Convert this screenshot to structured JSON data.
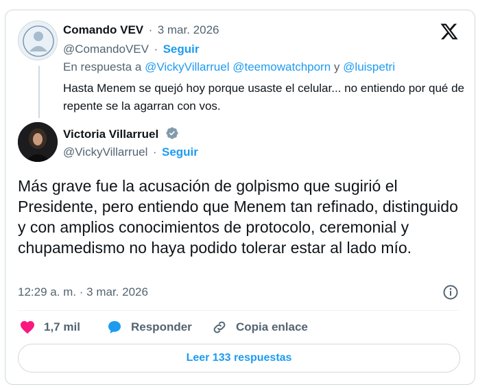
{
  "reply_tweet": {
    "author_name": "Comando VEV",
    "separator": "·",
    "date": "3 mar. 2026",
    "handle": "@ComandoVEV",
    "follow_label": "Seguir",
    "reply_prefix": "En respuesta a",
    "reply_to": [
      "@VickyVillarruel",
      "@teemowatchporn",
      "@luispetri"
    ],
    "reply_joiner": "y",
    "text": "Hasta Menem se quejó hoy porque usaste el celular... no entiendo por qué de repente se la agarran con vos."
  },
  "main_tweet": {
    "author_name": "Victoria Villarruel",
    "verified": true,
    "handle": "@VickyVillarruel",
    "follow_label": "Seguir",
    "text": "Más grave fue la acusación de golpismo que sugirió el Presidente, pero entiendo que Menem tan refinado, distinguido y con amplios conocimientos de protocolo, ceremonial y chupamedismo no haya podido tolerar estar al lado mío.",
    "timestamp": "12:29 a. m. · 3 mar. 2026"
  },
  "actions": {
    "likes": "1,7 mil",
    "reply_label": "Responder",
    "copy_link_label": "Copia enlace"
  },
  "read_replies_label": "Leer 133 respuestas",
  "colors": {
    "accent": "#1d9bf0",
    "like": "#f91880",
    "muted": "#536471",
    "border": "#cfd9de"
  },
  "icons": [
    "x-logo-icon",
    "verified-badge-icon",
    "info-icon",
    "heart-icon",
    "reply-bubble-icon",
    "link-icon"
  ]
}
